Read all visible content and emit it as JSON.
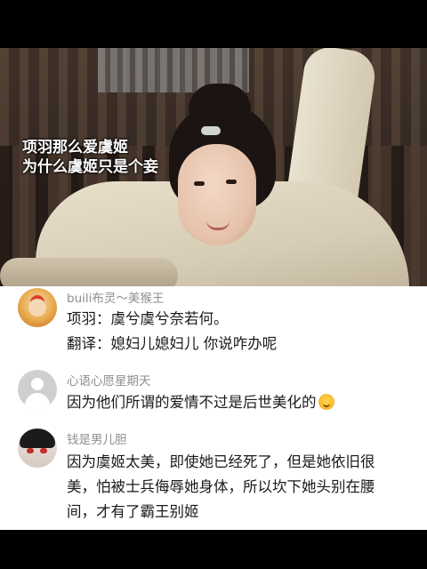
{
  "video": {
    "caption_line1": "项羽那么爱虞姬",
    "caption_line2": "为什么虞姬只是个妾"
  },
  "comments": [
    {
      "username": "buili布灵～美猴王",
      "avatar": "monkey-king-avatar",
      "line1": "项羽：虞兮虞兮奈若何。",
      "line2": "翻译：媳妇儿媳妇儿 你说咋办呢"
    },
    {
      "username": "心语心愿星期天",
      "avatar": "default-user-avatar",
      "text": "因为他们所谓的爱情不过是后世美化的",
      "emoji": "grinning-sweat-emoji"
    },
    {
      "username": "钱是男儿胆",
      "avatar": "anime-character-avatar",
      "line1": "因为虞姬太美，即使她已经死了，但是她依旧很",
      "line2": "美，怕被士兵侮辱她身体，所以坎下她头别在腰",
      "line3": "间，才有了霸王别姬"
    }
  ],
  "colors": {
    "username": "#8f8f8f",
    "text": "#1a1a1a",
    "caption": "#ffffff"
  }
}
